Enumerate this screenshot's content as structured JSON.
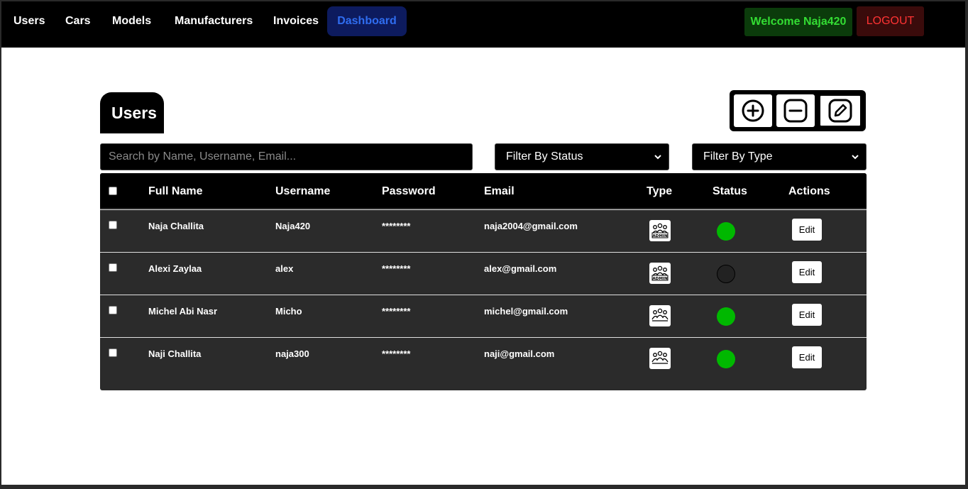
{
  "nav": {
    "links": [
      "Users",
      "Cars",
      "Models",
      "Manufacturers",
      "Invoices"
    ],
    "dashboard": "Dashboard",
    "welcome": "Welcome Naja420",
    "logout": "LOGOUT"
  },
  "page": {
    "title": "Users",
    "action_icons": [
      "plus-circle-icon",
      "minus-square-icon",
      "pencil-edit-icon"
    ]
  },
  "filters": {
    "search_placeholder": "Search by Name, Username, Email...",
    "status_label": "Filter By Status",
    "type_label": "Filter By Type"
  },
  "table": {
    "headers": {
      "full_name": "Full Name",
      "username": "Username",
      "password": "Password",
      "email": "Email",
      "type": "Type",
      "status": "Status",
      "actions": "Actions"
    },
    "rows": [
      {
        "full_name": "Naja Challita",
        "username": "Naja420",
        "password": "********",
        "email": "naja2004@gmail.com",
        "type": "admin",
        "status": "active",
        "edit": "Edit"
      },
      {
        "full_name": "Alexi Zaylaa",
        "username": "alex",
        "password": "********",
        "email": "alex@gmail.com",
        "type": "admin",
        "status": "inactive",
        "edit": "Edit"
      },
      {
        "full_name": "Michel Abi Nasr",
        "username": "Micho",
        "password": "********",
        "email": "michel@gmail.com",
        "type": "user",
        "status": "active",
        "edit": "Edit"
      },
      {
        "full_name": "Naji Challita",
        "username": "naja300",
        "password": "********",
        "email": "naji@gmail.com",
        "type": "user",
        "status": "active",
        "edit": "Edit"
      }
    ]
  },
  "colors": {
    "active": "#00b800",
    "inactive": "#222222",
    "dashboard_text": "#2f6df0",
    "welcome_text": "#33dd33",
    "logout_text": "#ff3333"
  }
}
